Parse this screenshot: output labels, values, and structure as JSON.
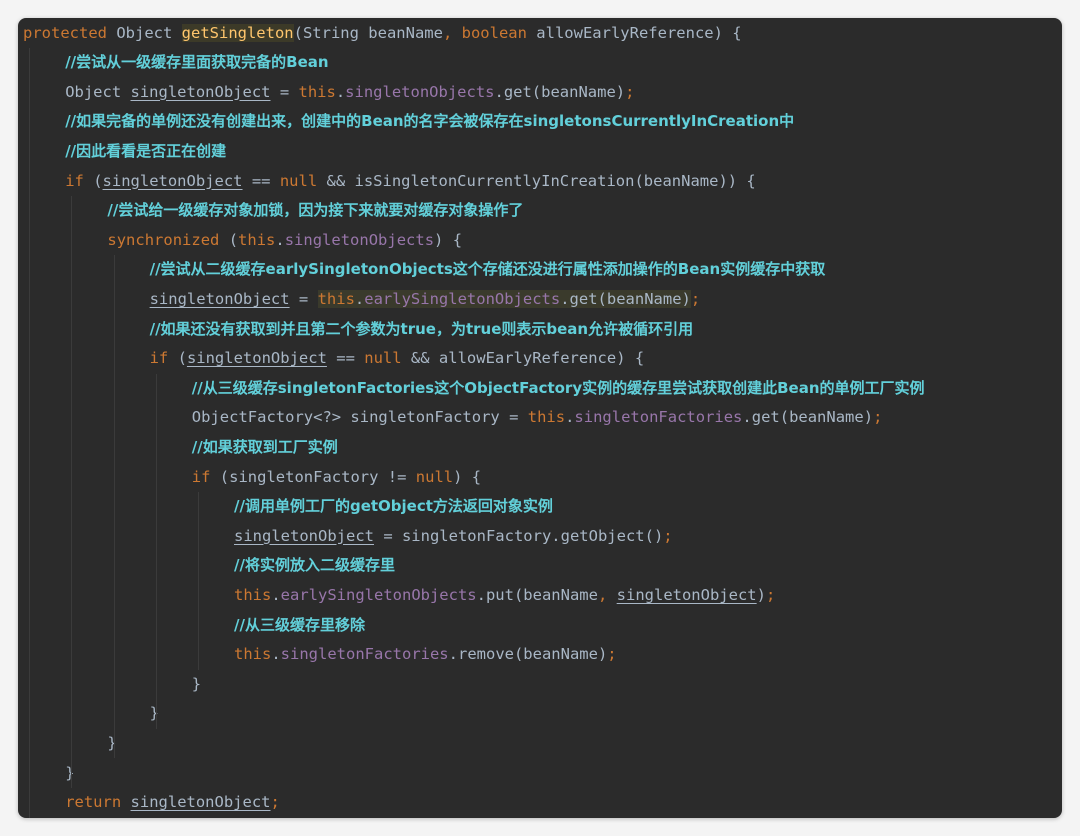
{
  "editor": {
    "lines": [
      {
        "indent": 0,
        "tokens": [
          {
            "t": "protected",
            "k": "kw"
          },
          {
            "t": " Object "
          },
          {
            "t": "getSingleton",
            "k": "fn"
          },
          {
            "t": "(String beanName"
          },
          {
            "t": ",",
            "k": "kw"
          },
          {
            "t": " "
          },
          {
            "t": "boolean",
            "k": "kw"
          },
          {
            "t": " allowEarlyReference) {"
          }
        ]
      },
      {
        "indent": 1,
        "tokens": [
          {
            "t": "//尝试从一级缓存里面获取完备的Bean",
            "k": "cmt"
          }
        ]
      },
      {
        "indent": 1,
        "tokens": [
          {
            "t": "Object "
          },
          {
            "t": "singletonObject",
            "k": "ul"
          },
          {
            "t": " = "
          },
          {
            "t": "this",
            "k": "kw"
          },
          {
            "t": "."
          },
          {
            "t": "singletonObjects",
            "k": "fld"
          },
          {
            "t": ".get(beanName)"
          },
          {
            "t": ";",
            "k": "kw"
          }
        ]
      },
      {
        "indent": 1,
        "tokens": [
          {
            "t": "//如果完备的单例还没有创建出来，创建中的Bean的名字会被保存在singletonsCurrentlyInCreation中",
            "k": "cmt"
          }
        ]
      },
      {
        "indent": 1,
        "tokens": [
          {
            "t": "//因此看看是否正在创建",
            "k": "cmt"
          }
        ]
      },
      {
        "indent": 1,
        "tokens": [
          {
            "t": "if",
            "k": "kw"
          },
          {
            "t": " ("
          },
          {
            "t": "singletonObject",
            "k": "ul"
          },
          {
            "t": " == "
          },
          {
            "t": "null",
            "k": "kw"
          },
          {
            "t": " && isSingletonCurrentlyInCreation(beanName)) {"
          }
        ]
      },
      {
        "indent": 2,
        "tokens": [
          {
            "t": "//尝试给一级缓存对象加锁，因为接下来就要对缓存对象操作了",
            "k": "cmt"
          }
        ]
      },
      {
        "indent": 2,
        "tokens": [
          {
            "t": "synchronized",
            "k": "kw"
          },
          {
            "t": " ("
          },
          {
            "t": "this",
            "k": "kw"
          },
          {
            "t": "."
          },
          {
            "t": "singletonObjects",
            "k": "fld"
          },
          {
            "t": ") {"
          }
        ]
      },
      {
        "indent": 3,
        "tokens": [
          {
            "t": "//尝试从二级缓存earlySingletonObjects这个存储还没进行属性添加操作的Bean实例缓存中获取",
            "k": "cmt"
          }
        ]
      },
      {
        "indent": 3,
        "tokens": [
          {
            "t": "singletonObject",
            "k": "ul"
          },
          {
            "t": " = "
          },
          {
            "t": "this",
            "k": "kw",
            "hl": true
          },
          {
            "t": ".",
            "hl": true
          },
          {
            "t": "earlySingletonObjects",
            "k": "fld",
            "hl": true
          },
          {
            "t": ".get(beanName)",
            "hl": true
          },
          {
            "t": ";",
            "k": "kw"
          }
        ]
      },
      {
        "indent": 3,
        "tokens": [
          {
            "t": "//如果还没有获取到并且第二个参数为true，为true则表示bean允许被循环引用",
            "k": "cmt"
          }
        ]
      },
      {
        "indent": 3,
        "tokens": [
          {
            "t": "if",
            "k": "kw"
          },
          {
            "t": " ("
          },
          {
            "t": "singletonObject",
            "k": "ul"
          },
          {
            "t": " == "
          },
          {
            "t": "null",
            "k": "kw"
          },
          {
            "t": " && allowEarlyReference) {"
          }
        ]
      },
      {
        "indent": 4,
        "tokens": [
          {
            "t": "//从三级缓存singletonFactories这个ObjectFactory实例的缓存里尝试获取创建此Bean的单例工厂实例",
            "k": "cmt"
          }
        ]
      },
      {
        "indent": 4,
        "tokens": [
          {
            "t": "ObjectFactory<?> singletonFactory = "
          },
          {
            "t": "this",
            "k": "kw"
          },
          {
            "t": "."
          },
          {
            "t": "singletonFactories",
            "k": "fld"
          },
          {
            "t": ".get(beanName)"
          },
          {
            "t": ";",
            "k": "kw"
          }
        ]
      },
      {
        "indent": 4,
        "tokens": [
          {
            "t": "//如果获取到工厂实例",
            "k": "cmt"
          }
        ]
      },
      {
        "indent": 4,
        "tokens": [
          {
            "t": "if",
            "k": "kw"
          },
          {
            "t": " (singletonFactory != "
          },
          {
            "t": "null",
            "k": "kw"
          },
          {
            "t": ") {"
          }
        ]
      },
      {
        "indent": 5,
        "tokens": [
          {
            "t": "//调用单例工厂的getObject方法返回对象实例",
            "k": "cmt"
          }
        ]
      },
      {
        "indent": 5,
        "tokens": [
          {
            "t": "singletonObject",
            "k": "ul"
          },
          {
            "t": " = singletonFactory.getObject()"
          },
          {
            "t": ";",
            "k": "kw"
          }
        ]
      },
      {
        "indent": 5,
        "tokens": [
          {
            "t": "//将实例放入二级缓存里",
            "k": "cmt"
          }
        ]
      },
      {
        "indent": 5,
        "tokens": [
          {
            "t": "this",
            "k": "kw"
          },
          {
            "t": "."
          },
          {
            "t": "earlySingletonObjects",
            "k": "fld"
          },
          {
            "t": ".put(beanName"
          },
          {
            "t": ",",
            "k": "kw"
          },
          {
            "t": " "
          },
          {
            "t": "singletonObject",
            "k": "ul"
          },
          {
            "t": ")"
          },
          {
            "t": ";",
            "k": "kw"
          }
        ]
      },
      {
        "indent": 5,
        "tokens": [
          {
            "t": "//从三级缓存里移除",
            "k": "cmt"
          }
        ]
      },
      {
        "indent": 5,
        "tokens": [
          {
            "t": "this",
            "k": "kw"
          },
          {
            "t": "."
          },
          {
            "t": "singletonFactories",
            "k": "fld"
          },
          {
            "t": ".remove(beanName)"
          },
          {
            "t": ";",
            "k": "kw"
          }
        ]
      },
      {
        "indent": 4,
        "tokens": [
          {
            "t": "}"
          }
        ]
      },
      {
        "indent": 3,
        "tokens": [
          {
            "t": "}"
          }
        ]
      },
      {
        "indent": 2,
        "tokens": [
          {
            "t": "}"
          }
        ]
      },
      {
        "indent": 1,
        "tokens": [
          {
            "t": "}"
          }
        ]
      },
      {
        "indent": 1,
        "tokens": [
          {
            "t": "return",
            "k": "kw"
          },
          {
            "t": " "
          },
          {
            "t": "singletonObject",
            "k": "ul"
          },
          {
            "t": ";",
            "k": "kw"
          }
        ]
      }
    ]
  },
  "colors": {
    "background": "#2b2b2b",
    "keyword": "#cc7832",
    "field": "#9876aa",
    "method_declaration": "#ffc66d",
    "comment": "#62d0da",
    "default_text": "#a9b7c6"
  }
}
